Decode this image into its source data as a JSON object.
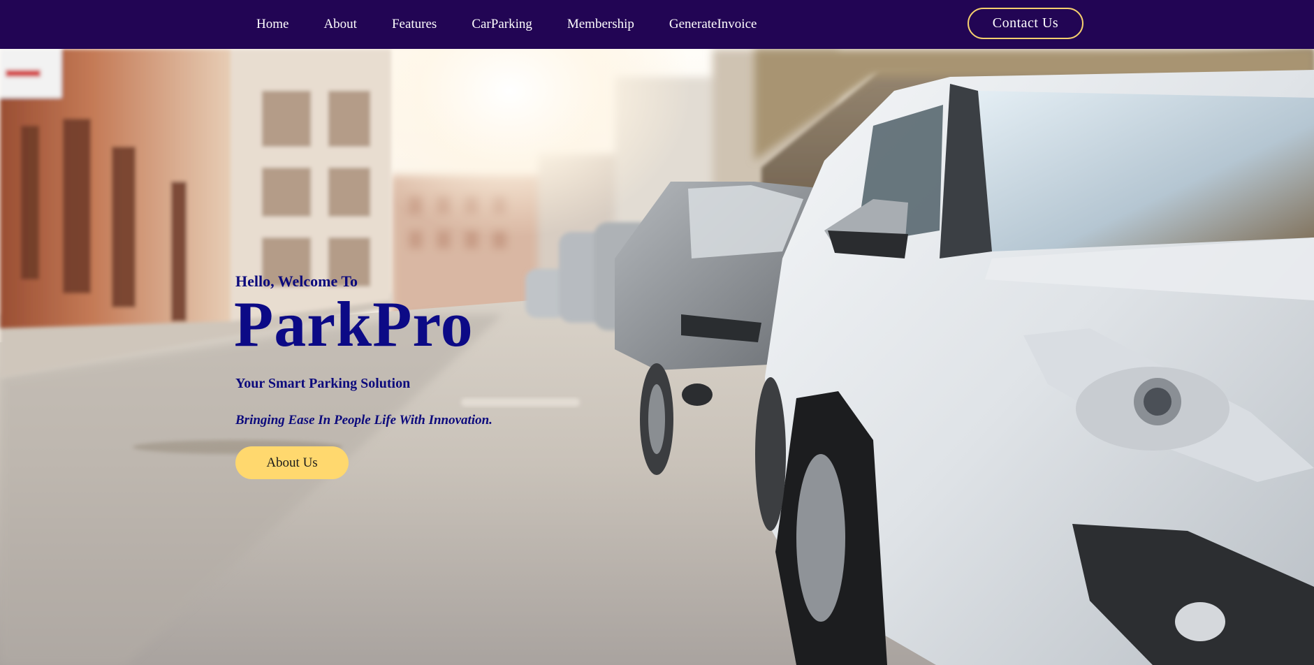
{
  "nav": {
    "links": [
      {
        "label": "Home"
      },
      {
        "label": "About"
      },
      {
        "label": "Features"
      },
      {
        "label": "CarParking"
      },
      {
        "label": "Membership"
      },
      {
        "label": "GenerateInvoice"
      }
    ],
    "contact_label": "Contact Us"
  },
  "hero": {
    "greeting": "Hello, Welcome To",
    "brand": "ParkPro",
    "tagline": "Your Smart Parking Solution",
    "slogan": "Bringing Ease In People Life With Innovation.",
    "button_label": "About Us"
  },
  "colors": {
    "navbar_bg": "#220554",
    "accent_yellow": "#ffd86e",
    "contact_border": "#f5d06e",
    "hero_text": "#0c0a7c"
  }
}
